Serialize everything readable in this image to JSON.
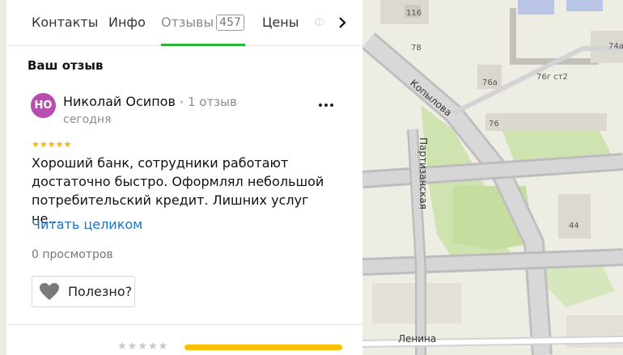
{
  "tabs": [
    {
      "label": "Контакты"
    },
    {
      "label": "Инфо"
    },
    {
      "label": "Отзывы",
      "count": "457"
    },
    {
      "label": "Цены"
    },
    {
      "label": "Ф"
    }
  ],
  "review": {
    "section_title": "Ваш отзыв",
    "avatar_initials": "НО",
    "author_name": "Николай Осипов",
    "separator": "•",
    "author_reviews": "1 отзыв",
    "date": "сегодня",
    "rating": 5,
    "text": "Хороший банк, сотрудники работают достаточно быстро. Оформлял небольшой потребительский кредит. Лишних услуг не…",
    "read_more": "Читать целиком",
    "views": "0 просмотров",
    "useful_label": "Полезно?"
  },
  "next_review": {
    "rating": 0,
    "bar_fill": 1.0
  },
  "map": {
    "street_labels": [
      "Копылова",
      "Партизанская",
      "Ленина"
    ],
    "building_numbers": [
      "116",
      "78",
      "74а",
      "76а",
      "76г ст2",
      "76",
      "44"
    ]
  },
  "colors": {
    "accent": "#2db33b",
    "link": "#1f72c6",
    "star": "#f9b900",
    "avatar": "#b74fb0",
    "bar": "#fbbf00"
  }
}
